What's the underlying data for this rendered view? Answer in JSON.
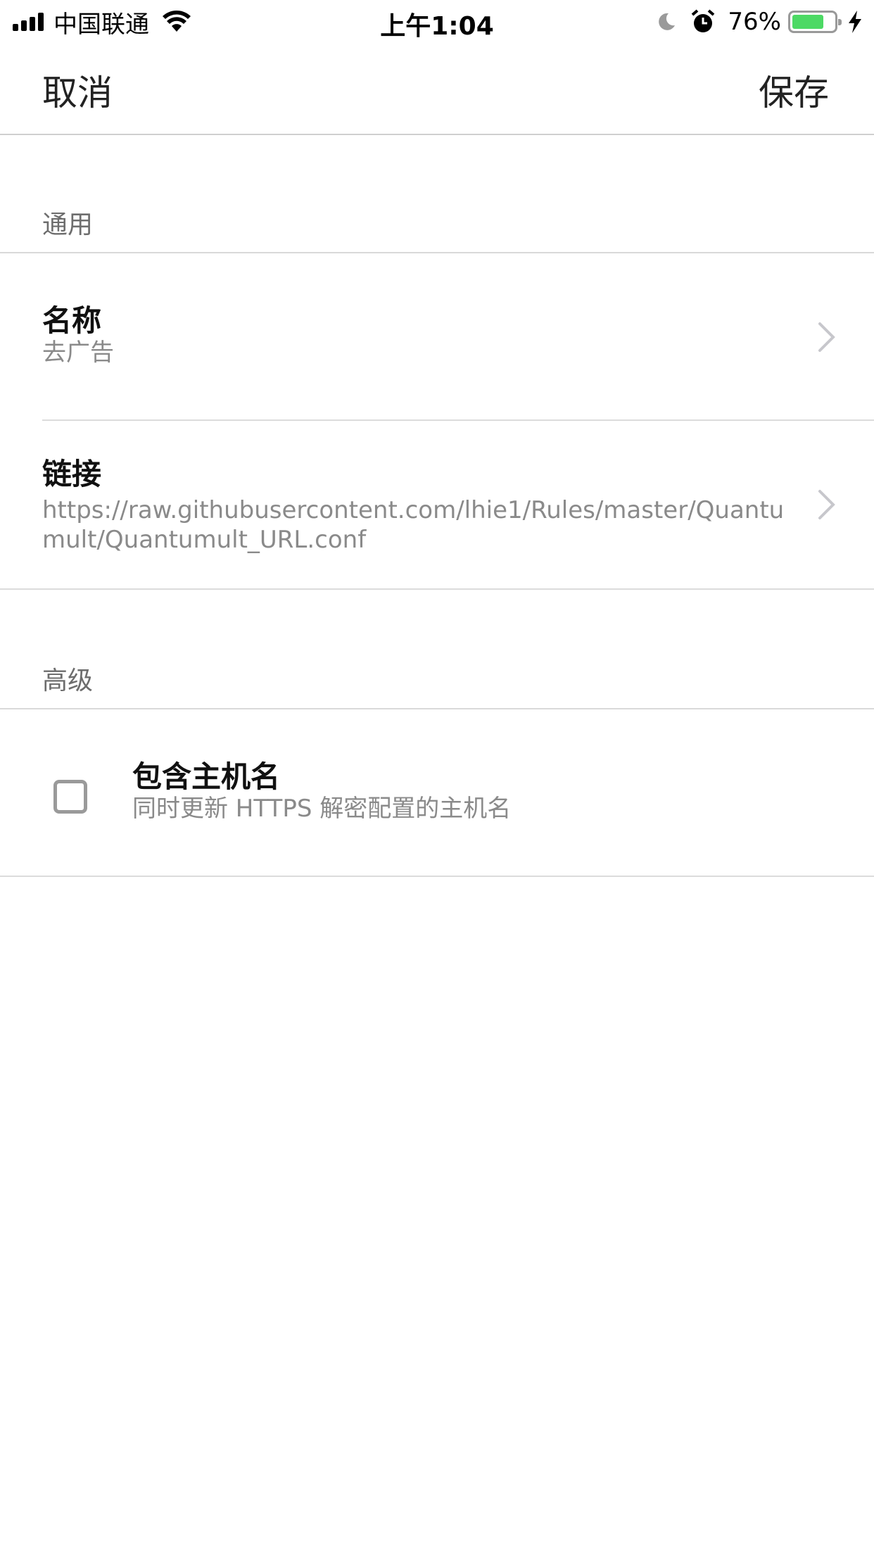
{
  "status_bar": {
    "carrier": "中国联通",
    "time": "上午1:04",
    "battery_percent": "76%",
    "battery_level": 0.76,
    "icons": [
      "signal-icon",
      "wifi-icon",
      "moon-icon",
      "alarm-icon",
      "battery-icon",
      "charging-bolt-icon"
    ]
  },
  "nav": {
    "cancel_label": "取消",
    "save_label": "保存"
  },
  "sections": {
    "general": {
      "header": "通用",
      "name_row": {
        "title": "名称",
        "value": "去广告"
      },
      "link_row": {
        "title": "链接",
        "value_line1": "https://raw.githubusercontent.com/lhie1/Rules/master/Quantu",
        "value_line2": "mult/Quantumult_URL.conf"
      }
    },
    "advanced": {
      "header": "高级",
      "include_hostname": {
        "title": "包含主机名",
        "subtitle": "同时更新 HTTPS 解密配置的主机名",
        "checked": false
      }
    }
  },
  "colors": {
    "battery_fill": "#4cd964",
    "secondary_text": "#8a8a8a",
    "divider": "#dcdcdc"
  }
}
